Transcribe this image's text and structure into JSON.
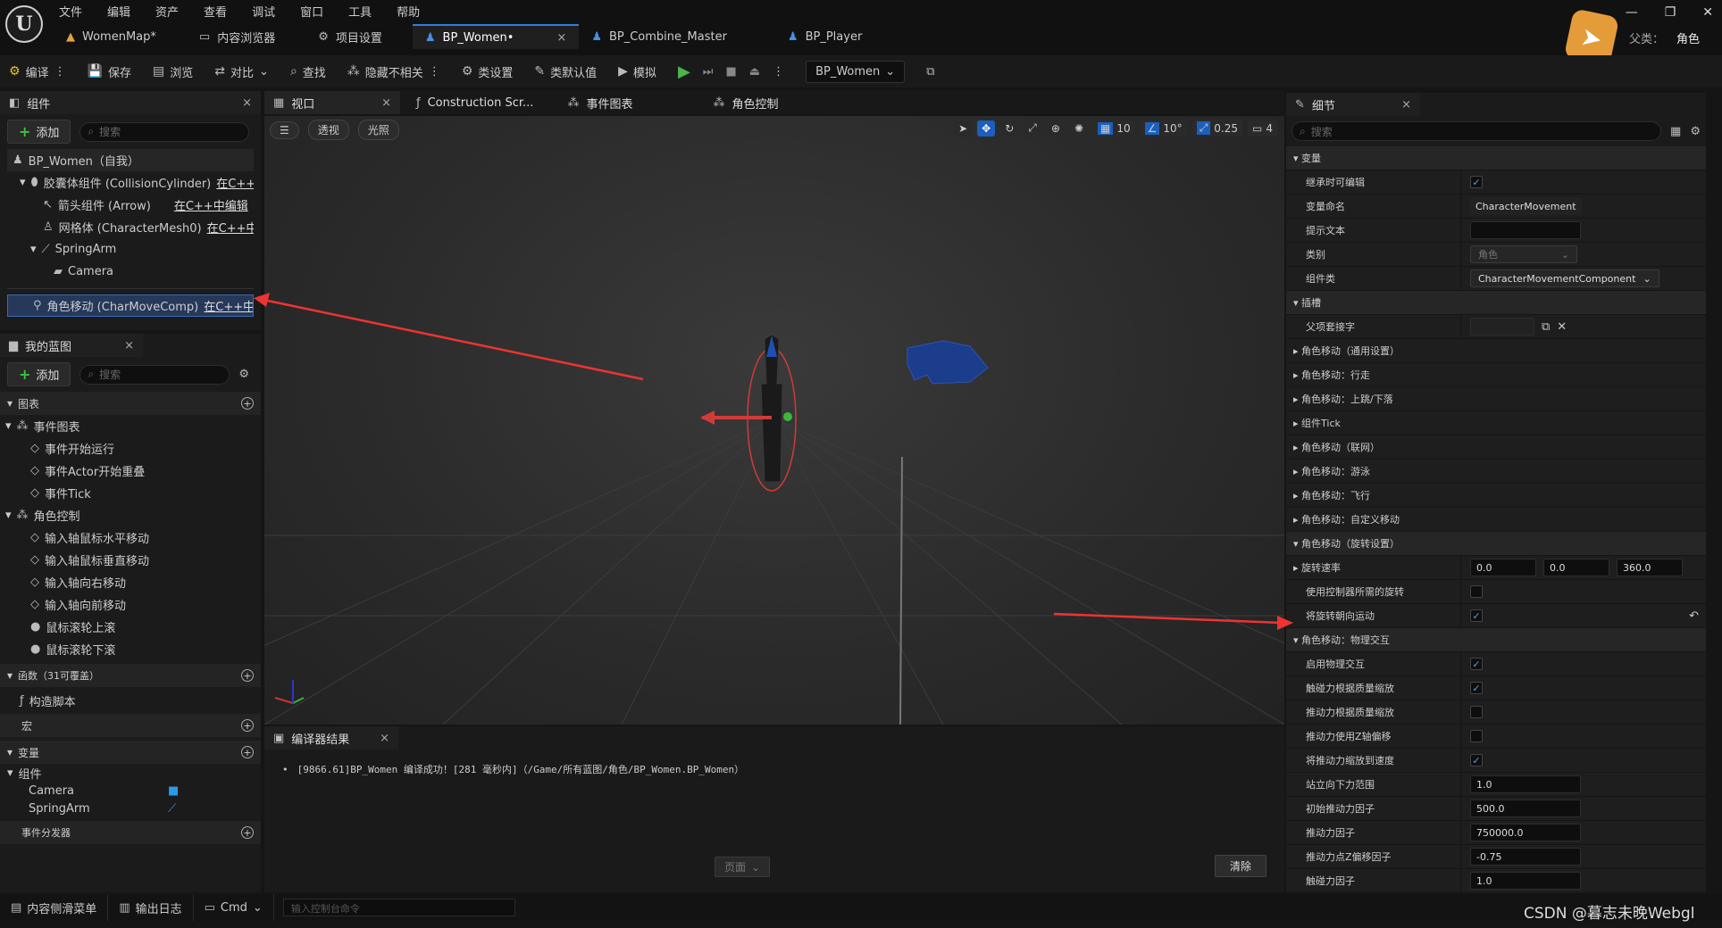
{
  "menu": [
    "文件",
    "编辑",
    "资产",
    "查看",
    "调试",
    "窗口",
    "工具",
    "帮助"
  ],
  "doc_tabs": [
    {
      "label": "WomenMap*",
      "icon": "map-icon"
    },
    {
      "label": "内容浏览器",
      "icon": "folder-icon"
    },
    {
      "label": "项目设置",
      "icon": "gear-icon"
    },
    {
      "label": "BP_Women•",
      "icon": "blueprint-icon",
      "active": true
    },
    {
      "label": "BP_Combine_Master",
      "icon": "blueprint-icon"
    },
    {
      "label": "BP_Player",
      "icon": "blueprint-icon"
    }
  ],
  "parent_label": "父类：",
  "parent_value": "角色",
  "toolbar": {
    "compile": "编译",
    "save": "保存",
    "browse": "浏览",
    "diff": "对比",
    "find": "查找",
    "hide": "隐藏不相关",
    "class_settings": "类设置",
    "class_defaults": "类默认值",
    "simulate": "模拟",
    "debug_object": "BP_Women"
  },
  "components": {
    "tab": "组件",
    "add": "添加",
    "search_placeholder": "搜索",
    "items": [
      {
        "label": "BP_Women（自我）",
        "link": ""
      },
      {
        "label": "胶囊体组件 (CollisionCylinder)",
        "link": "在C++中"
      },
      {
        "label": "箭头组件 (Arrow)",
        "link": "在C++中编辑"
      },
      {
        "label": "网格体 (CharacterMesh0)",
        "link": "在C++中编"
      },
      {
        "label": "SpringArm",
        "link": ""
      },
      {
        "label": "Camera",
        "link": ""
      },
      {
        "label": "角色移动 (CharMoveComp)",
        "link": "在C++中编"
      }
    ]
  },
  "my_blueprint": {
    "tab": "我的蓝图",
    "add": "添加",
    "search_placeholder": "搜索",
    "graphs": "图表",
    "event_graph": "事件图表",
    "events": [
      "事件开始运行",
      "事件Actor开始重叠",
      "事件Tick"
    ],
    "char_control": "角色控制",
    "inputs": [
      "输入轴鼠标水平移动",
      "输入轴鼠标垂直移动",
      "输入轴向右移动",
      "输入轴向前移动",
      "鼠标滚轮上滚",
      "鼠标滚轮下滚"
    ],
    "functions": "函数（31可覆盖）",
    "construct": "构造脚本",
    "macros": "宏",
    "variables": "变量",
    "components_group": "组件",
    "vars": [
      "Camera",
      "SpringArm"
    ],
    "dispatchers": "事件分发器"
  },
  "center_tabs": [
    {
      "label": "视口",
      "icon": "viewport-icon"
    },
    {
      "label": "Construction Scr...",
      "icon": "function-icon"
    },
    {
      "label": "事件图表",
      "icon": "graph-icon"
    },
    {
      "label": "角色控制",
      "icon": "graph-icon"
    }
  ],
  "viewport": {
    "perspective": "透视",
    "lit": "光照",
    "grid": "10",
    "angle": "10°",
    "scale": "0.25",
    "camera_speed": "4"
  },
  "compiler": {
    "tab": "编译器结果",
    "message": "[9866.61]BP_Women 编译成功！[281 毫秒内]（/Game/所有蓝图/角色/BP_Women.BP_Women）",
    "page": "页面",
    "clear": "清除"
  },
  "details": {
    "tab": "细节",
    "search_placeholder": "搜索",
    "rows": [
      {
        "type": "cat",
        "label": "变量"
      },
      {
        "label": "继承时可编辑",
        "kind": "check",
        "checked": true
      },
      {
        "label": "变量命名",
        "kind": "text",
        "value": "CharacterMovement"
      },
      {
        "label": "提示文本",
        "kind": "input",
        "value": ""
      },
      {
        "label": "类别",
        "kind": "dropdown",
        "value": "角色"
      },
      {
        "label": "组件类",
        "kind": "dropdown",
        "value": "CharacterMovementComponent"
      },
      {
        "type": "cat",
        "label": "插槽"
      },
      {
        "label": "父项套接字",
        "kind": "socket",
        "value": ""
      },
      {
        "type": "sub",
        "label": "角色移动（通用设置）"
      },
      {
        "type": "sub",
        "label": "角色移动：行走"
      },
      {
        "type": "sub",
        "label": "角色移动：上跳/下落"
      },
      {
        "type": "sub",
        "label": "组件Tick"
      },
      {
        "type": "sub",
        "label": "角色移动（联网）"
      },
      {
        "type": "sub",
        "label": "角色移动：游泳"
      },
      {
        "type": "sub",
        "label": "角色移动：飞行"
      },
      {
        "type": "sub",
        "label": "角色移动：自定义移动"
      },
      {
        "type": "cat",
        "label": "角色移动（旋转设置）"
      },
      {
        "label": "旋转速率",
        "kind": "vec",
        "values": [
          "0.0",
          "0.0",
          "360.0"
        ],
        "expand": true
      },
      {
        "label": "使用控制器所需的旋转",
        "kind": "check",
        "checked": false
      },
      {
        "label": "将旋转朝向运动",
        "kind": "check",
        "checked": true,
        "reset": true
      },
      {
        "type": "cat",
        "label": "角色移动：物理交互"
      },
      {
        "label": "启用物理交互",
        "kind": "check",
        "checked": true
      },
      {
        "label": "触碰力根据质量缩放",
        "kind": "check",
        "checked": true
      },
      {
        "label": "推动力根据质量缩放",
        "kind": "check",
        "checked": false
      },
      {
        "label": "推动力使用Z轴偏移",
        "kind": "check",
        "checked": false
      },
      {
        "label": "将推动力缩放到速度",
        "kind": "check",
        "checked": true
      },
      {
        "label": "站立向下力范围",
        "kind": "input",
        "value": "1.0"
      },
      {
        "label": "初始推动力因子",
        "kind": "input",
        "value": "500.0"
      },
      {
        "label": "推动力因子",
        "kind": "input",
        "value": "750000.0"
      },
      {
        "label": "推动力点Z偏移因子",
        "kind": "input",
        "value": "-0.75"
      },
      {
        "label": "触碰力因子",
        "kind": "input",
        "value": "1.0"
      }
    ]
  },
  "statusbar": {
    "drawer": "内容侧滑菜单",
    "log": "输出日志",
    "cmd": "Cmd",
    "console_placeholder": "输入控制台命令"
  },
  "watermark": "CSDN @暮志未晚Webgl"
}
